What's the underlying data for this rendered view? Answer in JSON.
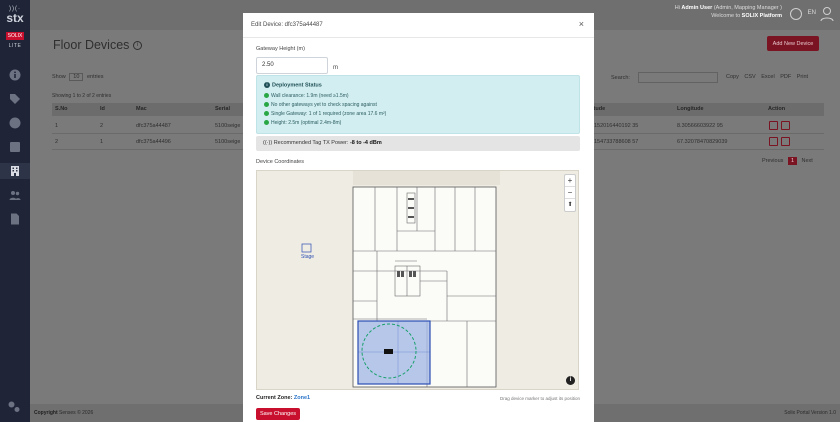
{
  "brand": {
    "mark": "))(·",
    "name": "stx",
    "badge": "SOLIX",
    "edition": "LITE"
  },
  "nav": [
    "info-icon",
    "tag-icon",
    "circle-icon",
    "box-icon",
    "building-icon",
    "users-icon",
    "document-icon"
  ],
  "topbar": {
    "greeting_prefix": "Hi",
    "user_name": "Admin User",
    "roles": "(Admin, Mapping Manager )",
    "welcome_prefix": "Welcome to",
    "platform": "SOLIX Platform",
    "lang": "EN"
  },
  "page": {
    "title": "Floor Devices",
    "add_button": "Add New Device",
    "show_label": "Show",
    "entries_value": "10",
    "entries_label": "entries",
    "search_label": "Search:",
    "exports": [
      "Copy",
      "CSV",
      "Excel",
      "PDF",
      "Print"
    ],
    "showing": "Showing 1 to 2 of 2 entries",
    "columns": [
      "S.No",
      "Id",
      "Mac",
      "Serial",
      "itude",
      "Longitude",
      "Action"
    ],
    "rows": [
      {
        "sno": "1",
        "id": "2",
        "mac": "dfc375a44487",
        "serial": "5100seige",
        "lat": "152016440192 35",
        "lng": "8.30566603922 95"
      },
      {
        "sno": "2",
        "id": "1",
        "mac": "dfc375a44496",
        "serial": "5100seige",
        "lat": "154733788608 57",
        "lng": "67.32078470829039"
      }
    ],
    "pager": {
      "prev": "Previous",
      "current": "1",
      "next": "Next"
    }
  },
  "footer": {
    "left_bold": "Copyright",
    "left_rest": "Senses © 2026",
    "right": "Solix Portal Version 1.0"
  },
  "modal": {
    "title": "Edit Device: dfc375a44487",
    "close": "×",
    "gateway_height_label": "Gateway Height (m)",
    "gateway_height_value": "2.50",
    "unit": "m",
    "status_title": "Deployment Status",
    "status_lines": [
      "Wall clearance: 1.9m (need ≥1.5m)",
      "No other gateways yet to check spacing against",
      "Single Gateway: 1 of 1 required (zone area 17.6 m²)",
      "Height: 2.5m (optimal 2.4m-8m)"
    ],
    "rec_prefix": "Recommended Tag TX Power:",
    "rec_value": "-8 to -4 dBm",
    "coords_label": "Device Coordinates",
    "map_label": "Stage",
    "current_zone_label": "Current Zone:",
    "current_zone_value": "Zone1",
    "drag_hint": "Drag device marker to adjust its position",
    "save": "Save Changes"
  }
}
